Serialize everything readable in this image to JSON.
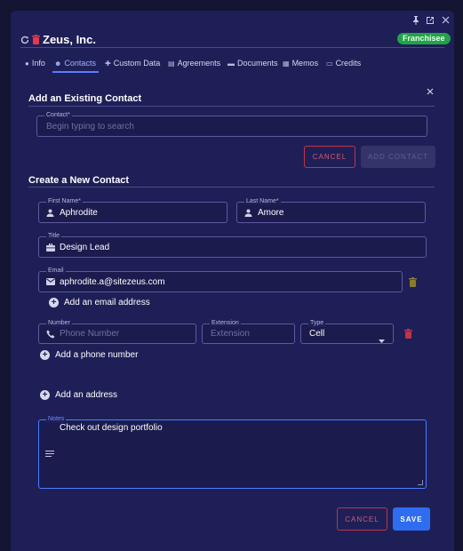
{
  "window": {
    "title": "Zeus, Inc.",
    "badge": "Franchisee"
  },
  "tabs": [
    {
      "label": "Info",
      "icon": "info-icon"
    },
    {
      "label": "Contacts",
      "icon": "people-icon",
      "active": true
    },
    {
      "label": "Custom Data",
      "icon": "puzzle-icon"
    },
    {
      "label": "Agreements",
      "icon": "document-icon"
    },
    {
      "label": "Documents",
      "icon": "folder-icon"
    },
    {
      "label": "Memos",
      "icon": "memo-icon"
    },
    {
      "label": "Credits",
      "icon": "credit-icon"
    }
  ],
  "existing": {
    "heading": "Add an Existing Contact",
    "contact_label": "Contact*",
    "contact_placeholder": "Begin typing to search",
    "cancel": "CANCEL",
    "add": "ADD CONTACT"
  },
  "new_contact": {
    "heading": "Create a New Contact",
    "first_name_label": "First Name*",
    "first_name": "Aphrodite",
    "last_name_label": "Last Name*",
    "last_name": "Amore",
    "title_label": "Title",
    "title": "Design Lead",
    "email_label": "Email",
    "email": "aphrodite.a@sitezeus.com",
    "add_email": "Add an email address",
    "number_label": "Number",
    "number_placeholder": "Phone Number",
    "extension_label": "Extension",
    "extension_placeholder": "Extension",
    "type_label": "Type",
    "type_value": "Cell",
    "add_phone": "Add a phone number",
    "add_address": "Add an address",
    "notes_label": "Notes",
    "notes": "Check out design portfolio"
  },
  "footer": {
    "cancel": "CANCEL",
    "save": "SAVE"
  },
  "colors": {
    "background": "#1f1f57",
    "accent": "#2f6df0",
    "badge": "#21a34a",
    "danger": "#c0334a"
  }
}
